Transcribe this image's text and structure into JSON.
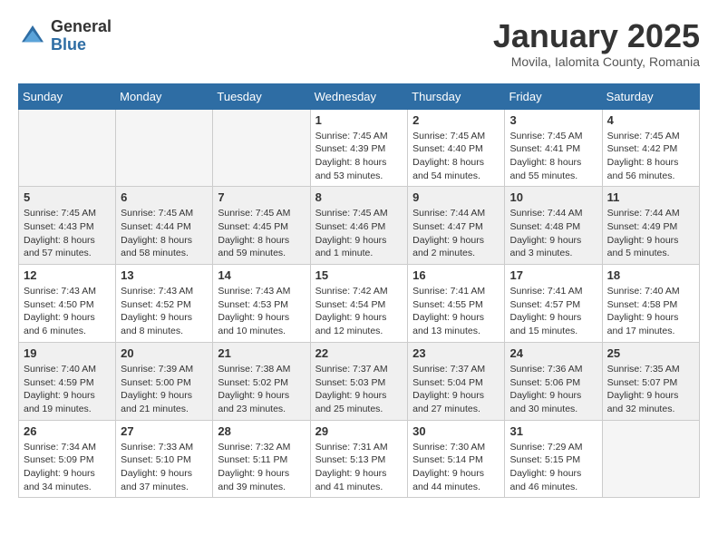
{
  "logo": {
    "general": "General",
    "blue": "Blue"
  },
  "title": "January 2025",
  "subtitle": "Movila, Ialomita County, Romania",
  "weekdays": [
    "Sunday",
    "Monday",
    "Tuesday",
    "Wednesday",
    "Thursday",
    "Friday",
    "Saturday"
  ],
  "weeks": [
    [
      {
        "day": null
      },
      {
        "day": null
      },
      {
        "day": null
      },
      {
        "day": "1",
        "sunrise": "Sunrise: 7:45 AM",
        "sunset": "Sunset: 4:39 PM",
        "daylight": "Daylight: 8 hours and 53 minutes."
      },
      {
        "day": "2",
        "sunrise": "Sunrise: 7:45 AM",
        "sunset": "Sunset: 4:40 PM",
        "daylight": "Daylight: 8 hours and 54 minutes."
      },
      {
        "day": "3",
        "sunrise": "Sunrise: 7:45 AM",
        "sunset": "Sunset: 4:41 PM",
        "daylight": "Daylight: 8 hours and 55 minutes."
      },
      {
        "day": "4",
        "sunrise": "Sunrise: 7:45 AM",
        "sunset": "Sunset: 4:42 PM",
        "daylight": "Daylight: 8 hours and 56 minutes."
      }
    ],
    [
      {
        "day": "5",
        "sunrise": "Sunrise: 7:45 AM",
        "sunset": "Sunset: 4:43 PM",
        "daylight": "Daylight: 8 hours and 57 minutes."
      },
      {
        "day": "6",
        "sunrise": "Sunrise: 7:45 AM",
        "sunset": "Sunset: 4:44 PM",
        "daylight": "Daylight: 8 hours and 58 minutes."
      },
      {
        "day": "7",
        "sunrise": "Sunrise: 7:45 AM",
        "sunset": "Sunset: 4:45 PM",
        "daylight": "Daylight: 8 hours and 59 minutes."
      },
      {
        "day": "8",
        "sunrise": "Sunrise: 7:45 AM",
        "sunset": "Sunset: 4:46 PM",
        "daylight": "Daylight: 9 hours and 1 minute."
      },
      {
        "day": "9",
        "sunrise": "Sunrise: 7:44 AM",
        "sunset": "Sunset: 4:47 PM",
        "daylight": "Daylight: 9 hours and 2 minutes."
      },
      {
        "day": "10",
        "sunrise": "Sunrise: 7:44 AM",
        "sunset": "Sunset: 4:48 PM",
        "daylight": "Daylight: 9 hours and 3 minutes."
      },
      {
        "day": "11",
        "sunrise": "Sunrise: 7:44 AM",
        "sunset": "Sunset: 4:49 PM",
        "daylight": "Daylight: 9 hours and 5 minutes."
      }
    ],
    [
      {
        "day": "12",
        "sunrise": "Sunrise: 7:43 AM",
        "sunset": "Sunset: 4:50 PM",
        "daylight": "Daylight: 9 hours and 6 minutes."
      },
      {
        "day": "13",
        "sunrise": "Sunrise: 7:43 AM",
        "sunset": "Sunset: 4:52 PM",
        "daylight": "Daylight: 9 hours and 8 minutes."
      },
      {
        "day": "14",
        "sunrise": "Sunrise: 7:43 AM",
        "sunset": "Sunset: 4:53 PM",
        "daylight": "Daylight: 9 hours and 10 minutes."
      },
      {
        "day": "15",
        "sunrise": "Sunrise: 7:42 AM",
        "sunset": "Sunset: 4:54 PM",
        "daylight": "Daylight: 9 hours and 12 minutes."
      },
      {
        "day": "16",
        "sunrise": "Sunrise: 7:41 AM",
        "sunset": "Sunset: 4:55 PM",
        "daylight": "Daylight: 9 hours and 13 minutes."
      },
      {
        "day": "17",
        "sunrise": "Sunrise: 7:41 AM",
        "sunset": "Sunset: 4:57 PM",
        "daylight": "Daylight: 9 hours and 15 minutes."
      },
      {
        "day": "18",
        "sunrise": "Sunrise: 7:40 AM",
        "sunset": "Sunset: 4:58 PM",
        "daylight": "Daylight: 9 hours and 17 minutes."
      }
    ],
    [
      {
        "day": "19",
        "sunrise": "Sunrise: 7:40 AM",
        "sunset": "Sunset: 4:59 PM",
        "daylight": "Daylight: 9 hours and 19 minutes."
      },
      {
        "day": "20",
        "sunrise": "Sunrise: 7:39 AM",
        "sunset": "Sunset: 5:00 PM",
        "daylight": "Daylight: 9 hours and 21 minutes."
      },
      {
        "day": "21",
        "sunrise": "Sunrise: 7:38 AM",
        "sunset": "Sunset: 5:02 PM",
        "daylight": "Daylight: 9 hours and 23 minutes."
      },
      {
        "day": "22",
        "sunrise": "Sunrise: 7:37 AM",
        "sunset": "Sunset: 5:03 PM",
        "daylight": "Daylight: 9 hours and 25 minutes."
      },
      {
        "day": "23",
        "sunrise": "Sunrise: 7:37 AM",
        "sunset": "Sunset: 5:04 PM",
        "daylight": "Daylight: 9 hours and 27 minutes."
      },
      {
        "day": "24",
        "sunrise": "Sunrise: 7:36 AM",
        "sunset": "Sunset: 5:06 PM",
        "daylight": "Daylight: 9 hours and 30 minutes."
      },
      {
        "day": "25",
        "sunrise": "Sunrise: 7:35 AM",
        "sunset": "Sunset: 5:07 PM",
        "daylight": "Daylight: 9 hours and 32 minutes."
      }
    ],
    [
      {
        "day": "26",
        "sunrise": "Sunrise: 7:34 AM",
        "sunset": "Sunset: 5:09 PM",
        "daylight": "Daylight: 9 hours and 34 minutes."
      },
      {
        "day": "27",
        "sunrise": "Sunrise: 7:33 AM",
        "sunset": "Sunset: 5:10 PM",
        "daylight": "Daylight: 9 hours and 37 minutes."
      },
      {
        "day": "28",
        "sunrise": "Sunrise: 7:32 AM",
        "sunset": "Sunset: 5:11 PM",
        "daylight": "Daylight: 9 hours and 39 minutes."
      },
      {
        "day": "29",
        "sunrise": "Sunrise: 7:31 AM",
        "sunset": "Sunset: 5:13 PM",
        "daylight": "Daylight: 9 hours and 41 minutes."
      },
      {
        "day": "30",
        "sunrise": "Sunrise: 7:30 AM",
        "sunset": "Sunset: 5:14 PM",
        "daylight": "Daylight: 9 hours and 44 minutes."
      },
      {
        "day": "31",
        "sunrise": "Sunrise: 7:29 AM",
        "sunset": "Sunset: 5:15 PM",
        "daylight": "Daylight: 9 hours and 46 minutes."
      },
      {
        "day": null
      }
    ]
  ]
}
